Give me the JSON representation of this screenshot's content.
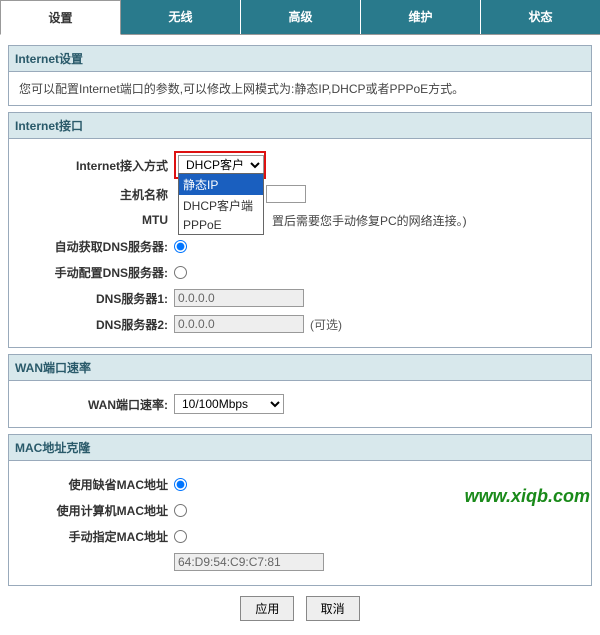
{
  "tabs": [
    "设置",
    "无线",
    "高级",
    "维护",
    "状态"
  ],
  "activeTab": 0,
  "sections": {
    "internet_settings": {
      "title": "Internet设置",
      "desc": "您可以配置Internet端口的参数,可以修改上网模式为:静态IP,DHCP或者PPPoE方式。"
    },
    "internet_iface": {
      "title": "Internet接口",
      "fields": {
        "access_label": "Internet接入方式",
        "access_value": "DHCP客户端",
        "access_options": [
          "静态IP",
          "DHCP客户端",
          "PPPoE"
        ],
        "access_selected_option": 0,
        "hostname_label": "主机名称",
        "hostname_value": "",
        "mtu_label": "MTU",
        "mtu_note": "置后需要您手动修复PC的网络连接。)",
        "autodns_label": "自动获取DNS服务器:",
        "manualdns_label": "手动配置DNS服务器:",
        "dns1_label": "DNS服务器1:",
        "dns1_value": "0.0.0.0",
        "dns2_label": "DNS服务器2:",
        "dns2_value": "0.0.0.0",
        "dns2_optional": "(可选)"
      }
    },
    "wan_rate": {
      "title": "WAN端口速率",
      "label": "WAN端口速率:",
      "value": "10/100Mbps"
    },
    "mac_clone": {
      "title": "MAC地址克隆",
      "default_label": "使用缺省MAC地址",
      "pc_label": "使用计算机MAC地址",
      "manual_label": "手动指定MAC地址",
      "mac_value": "64:D9:54:C9:C7:81"
    }
  },
  "buttons": {
    "apply": "应用",
    "cancel": "取消"
  },
  "watermark": "www.xiqb.com"
}
